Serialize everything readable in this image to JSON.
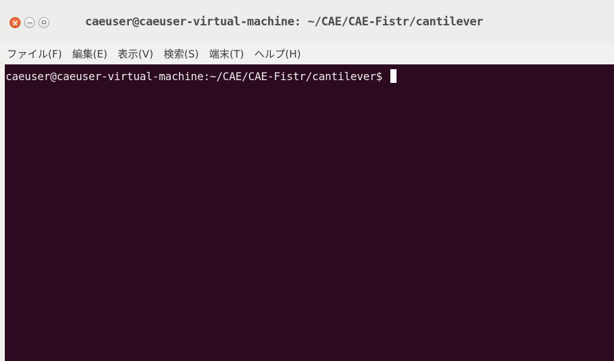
{
  "window": {
    "title": "caeuser@caeuser-virtual-machine: ~/CAE/CAE-Fistr/cantilever"
  },
  "menubar": {
    "items": [
      {
        "label": "ファイル(F)"
      },
      {
        "label": "編集(E)"
      },
      {
        "label": "表示(V)"
      },
      {
        "label": "検索(S)"
      },
      {
        "label": "端末(T)"
      },
      {
        "label": "ヘルプ(H)"
      }
    ]
  },
  "terminal": {
    "prompt": "caeuser@caeuser-virtual-machine:~/CAE/CAE-Fistr/cantilever$",
    "background": "#2c0a20",
    "foreground": "#eeeeec"
  },
  "controls": {
    "close_icon": "close-icon",
    "minimize_icon": "minimize-icon",
    "maximize_icon": "maximize-icon",
    "close_color": "#ee6631"
  }
}
